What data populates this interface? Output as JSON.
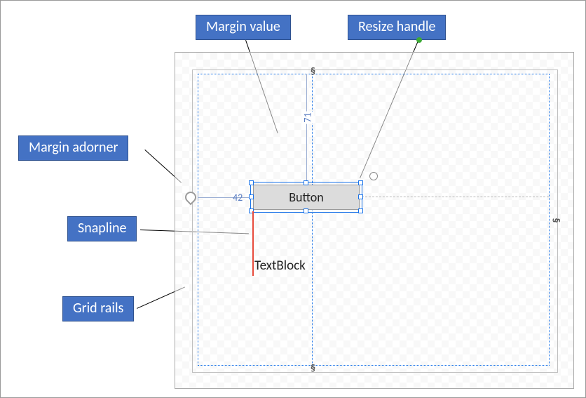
{
  "callouts": {
    "margin_value": "Margin value",
    "resize_handle": "Resize handle",
    "margin_adorner": "Margin adorner",
    "snapline": "Snapline",
    "grid_rails": "Grid rails"
  },
  "designer": {
    "button_label": "Button",
    "textblock_label": "TextBlock",
    "margin_left": "42",
    "margin_top": "71"
  },
  "colors": {
    "callout_fill": "#4472c4",
    "callout_border": "#2f528f",
    "snapline": "#e84b3c",
    "rail": "#1a73e8"
  }
}
